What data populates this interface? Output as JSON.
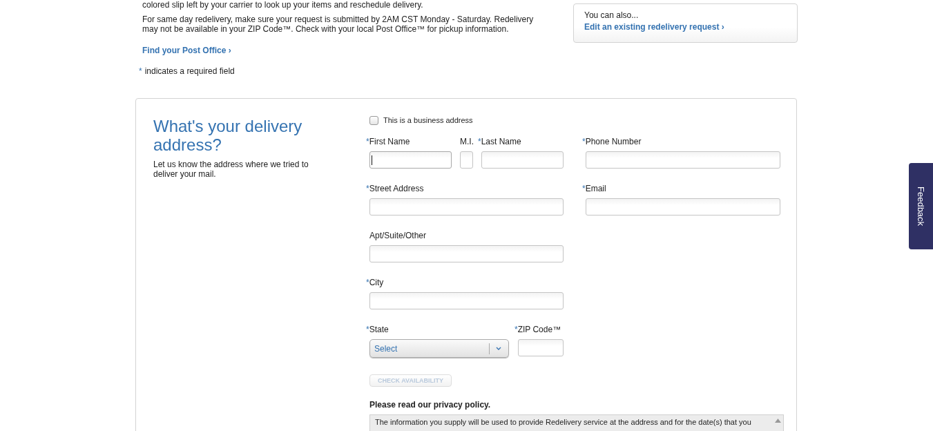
{
  "intro": {
    "paragraphs": [
      "colored slip left by your carrier to look up your items and reschedule delivery.",
      "For same day redelivery, make sure your request is submitted by 2AM CST Monday - Saturday. Redelivery may not be available in your ZIP Code™. Check with your local Post Office™ for pickup information."
    ],
    "link": "Find your Post Office",
    "link_arrow": "›",
    "required_note": {
      "mark": "*",
      "text": "indicates a required field"
    }
  },
  "side_box": {
    "lead": "You can also...",
    "link": "Edit an existing redelivery request",
    "link_arrow": "›"
  },
  "form": {
    "heading": "What's your delivery address?",
    "subheading": "Let us know the address where we tried to deliver your mail.",
    "business_checkbox": {
      "label": "This is a business address",
      "checked": false
    },
    "required_mark": "*",
    "rows": [
      {
        "left": [
          {
            "label": "First Name",
            "required": true,
            "kind": "text",
            "focused": true
          },
          {
            "label": "M.I.",
            "required": false,
            "kind": "initial"
          },
          {
            "label": "Last Name",
            "required": true,
            "kind": "text"
          }
        ],
        "right": [
          {
            "label": "Phone Number",
            "required": true,
            "kind": "text"
          }
        ]
      },
      {
        "left": [
          {
            "label": "Street Address",
            "required": true,
            "kind": "text"
          }
        ],
        "right": [
          {
            "label": "Email",
            "required": true,
            "kind": "text"
          }
        ]
      },
      {
        "left": [
          {
            "label": "Apt/Suite/Other",
            "required": false,
            "kind": "text"
          }
        ],
        "right": []
      },
      {
        "left": [
          {
            "label": "City",
            "required": true,
            "kind": "text"
          }
        ],
        "right": []
      },
      {
        "left": [
          {
            "label": "State",
            "required": true,
            "kind": "select",
            "value": "Select"
          },
          {
            "label": "ZIP Code™",
            "required": true,
            "kind": "zip"
          }
        ],
        "right": []
      }
    ],
    "check_button": {
      "label": "CHECK AVAILABILITY",
      "disabled": true
    },
    "privacy": {
      "heading": "Please read our privacy policy.",
      "text": "The information you supply will be used to provide Redelivery service at the address and for the date(s) that you"
    }
  },
  "feedback_tab": {
    "label": "Feedback"
  }
}
